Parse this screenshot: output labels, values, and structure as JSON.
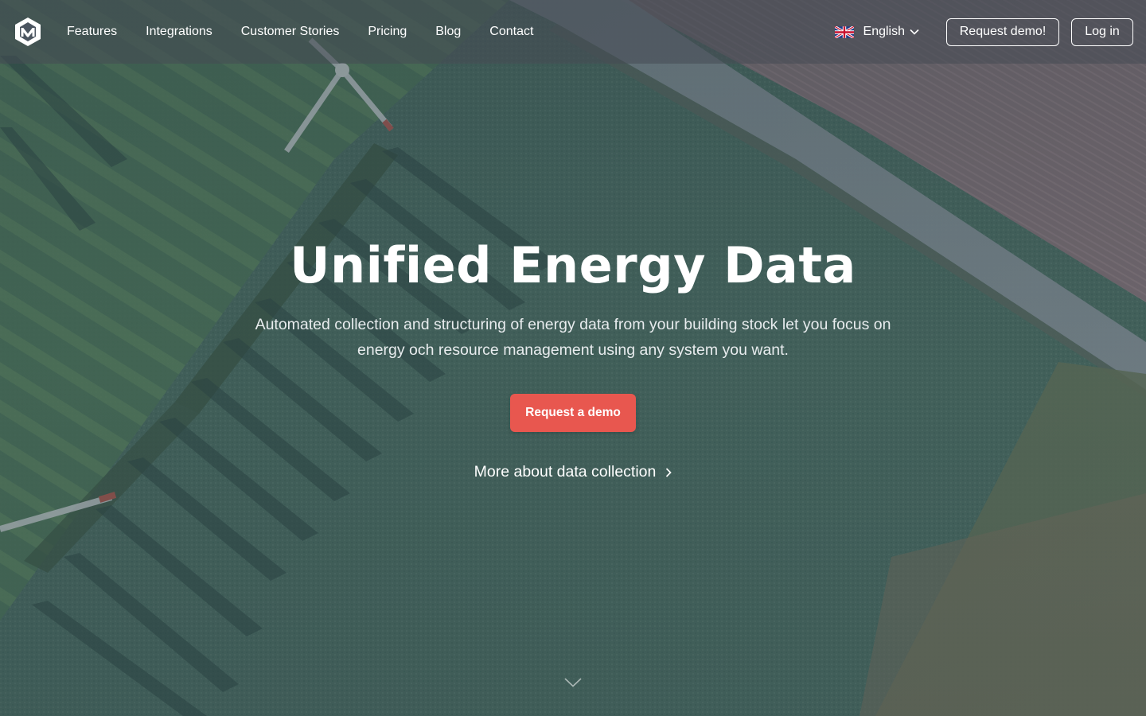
{
  "nav": {
    "logo": "logo-icon",
    "links": [
      "Features",
      "Integrations",
      "Customer Stories",
      "Pricing",
      "Blog",
      "Contact"
    ],
    "language": {
      "flag": "uk-flag-icon",
      "label": "English",
      "chevron": "chevron-down-icon"
    },
    "request_demo_label": "Request demo!",
    "login_label": "Log in"
  },
  "hero": {
    "title": "Unified Energy Data",
    "subtitle": "Automated collection and structuring of energy data from your building stock let you focus on energy och resource management using any system you want.",
    "cta_label": "Request a demo",
    "more_label": "More about data collection",
    "more_icon": "chevron-right-icon",
    "scroll_icon": "chevron-down-icon"
  },
  "colors": {
    "cta": "#e8574f",
    "navbar": "#464a54",
    "text": "#ffffff"
  }
}
